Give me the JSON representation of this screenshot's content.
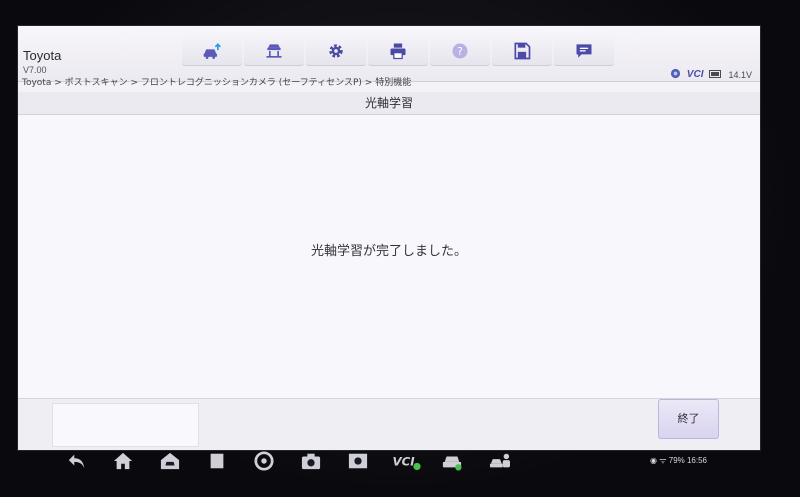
{
  "app": {
    "name": "Toyota",
    "version": "V7.00"
  },
  "toolbar": {
    "items": [
      {
        "icon": "car-upload-icon"
      },
      {
        "icon": "car-lift-icon"
      },
      {
        "icon": "gear-icon"
      },
      {
        "icon": "printer-icon"
      },
      {
        "icon": "help-icon"
      },
      {
        "icon": "save-icon"
      },
      {
        "icon": "message-icon"
      }
    ]
  },
  "status": {
    "vci_label": "VCI",
    "battery": "14.1V"
  },
  "breadcrumb": "Toyota > ポストスキャン > フロントレコグニッションカメラ (セーフティセンスP) > 特別機能",
  "page_title": "光軸学習",
  "message": "光軸学習が完了しました。",
  "footer": {
    "end_label": "終了"
  },
  "system": {
    "nav_vci_label": "VCI",
    "status": "79% 16:56"
  },
  "colors": {
    "accent": "#4a4eaa",
    "button_bg": "#d9d3ef",
    "screen_bg": "#f3f2f6"
  }
}
